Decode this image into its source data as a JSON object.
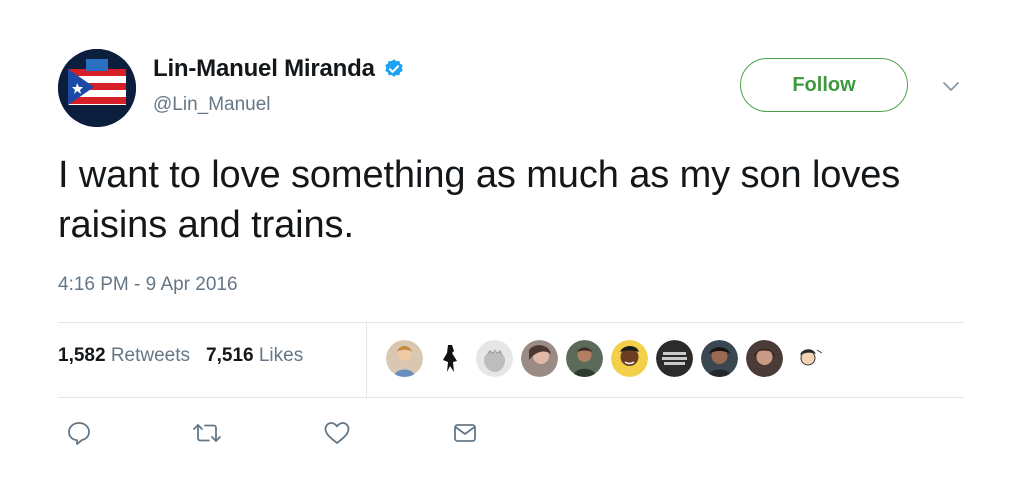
{
  "user": {
    "display_name": "Lin-Manuel Miranda",
    "handle": "@Lin_Manuel",
    "verified_icon": "verified-badge-icon",
    "avatar_icon": "puerto-rico-flag-avatar"
  },
  "header": {
    "follow_label": "Follow",
    "menu_icon": "chevron-down-icon"
  },
  "tweet": {
    "text": "I want to love something as much as my son loves raisins and trains.",
    "timestamp": "4:16 PM - 9 Apr 2016"
  },
  "stats": {
    "retweets_count": "1,582",
    "retweets_label": "Retweets",
    "likes_count": "7,516",
    "likes_label": "Likes"
  },
  "likers": [
    "liker-1",
    "liker-2",
    "liker-3",
    "liker-4",
    "liker-5",
    "liker-6",
    "liker-7",
    "liker-8",
    "liker-9",
    "liker-10"
  ],
  "actions": [
    "reply-icon",
    "retweet-icon",
    "like-icon",
    "message-icon"
  ],
  "colors": {
    "follow_green": "#3c9a3c",
    "verified_blue": "#1da1f2",
    "muted_text": "#657786"
  }
}
